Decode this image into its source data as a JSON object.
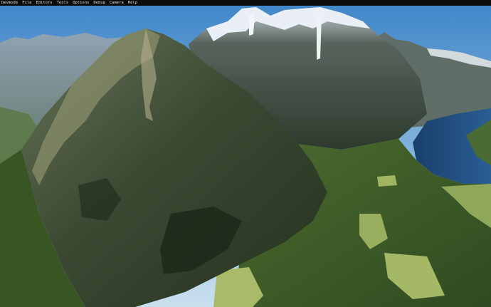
{
  "menubar": {
    "items": [
      "Devmode",
      "File",
      "Editors",
      "Tools",
      "Options",
      "Debug",
      "Camera",
      "Help"
    ]
  },
  "scene": {
    "description_label": "",
    "colors": {
      "sky_top": "#3f86c9",
      "sky_bottom": "#c9e0ef",
      "rock_dark": "#2f3a2a",
      "rock_mid": "#4f5a45",
      "forest": "#3f5e2a",
      "meadow": "#8ea45a",
      "lake": "#1f4a78",
      "snow": "#e8eef3"
    }
  }
}
